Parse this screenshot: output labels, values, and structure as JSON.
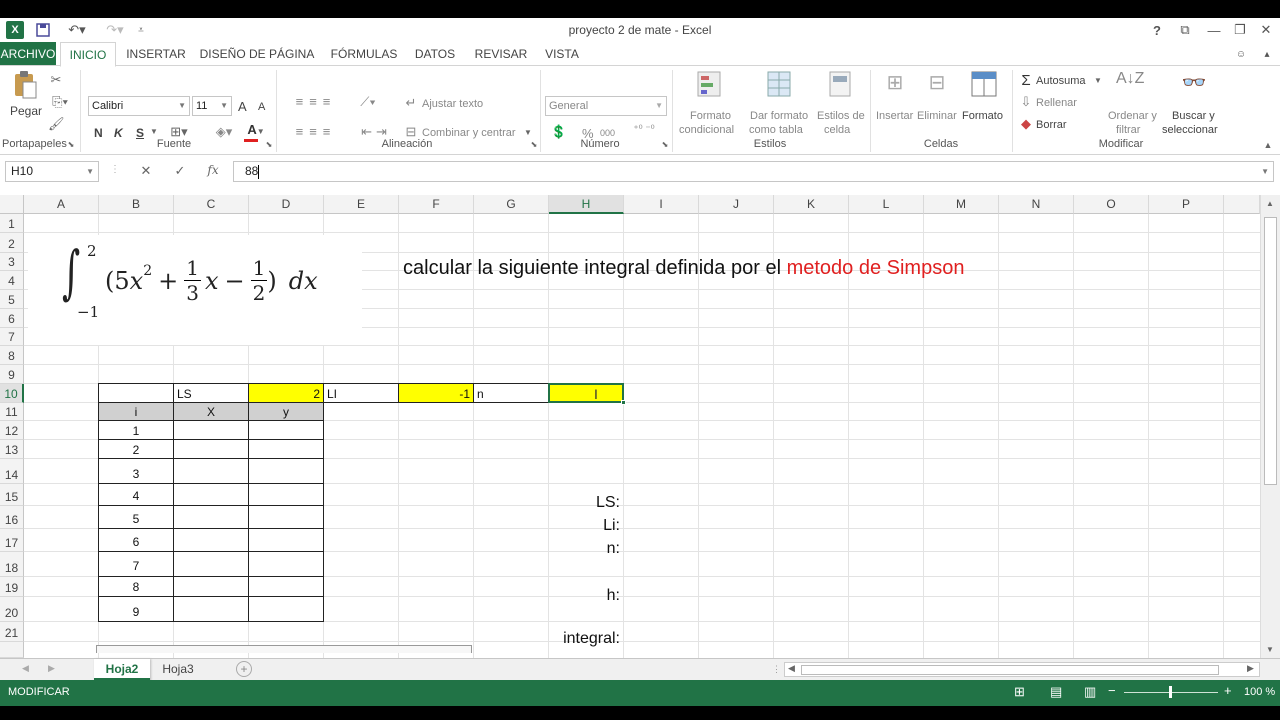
{
  "app": {
    "title": "proyecto 2 de mate - Excel",
    "logo_letter": "X",
    "quick_access": [
      "save-icon",
      "undo-icon",
      "redo-icon",
      "customize-icon"
    ],
    "window_controls": [
      "?",
      "⧉",
      "—",
      "❐",
      "✕"
    ]
  },
  "tabs": [
    "ARCHIVO",
    "INICIO",
    "INSERTAR",
    "DISEÑO DE PÁGINA",
    "FÓRMULAS",
    "DATOS",
    "REVISAR",
    "VISTA"
  ],
  "ribbon": {
    "clipboard": {
      "paste": "Pegar",
      "group": "Portapapeles"
    },
    "font": {
      "name": "Calibri",
      "size": "11",
      "bold": "N",
      "italic": "K",
      "underline": "S",
      "grow": "A",
      "shrink": "A",
      "group": "Fuente"
    },
    "alignment": {
      "wrap": "Ajustar texto",
      "merge": "Combinar y centrar",
      "group": "Alineación"
    },
    "number": {
      "format": "General",
      "percent": "%",
      "thousands": "000",
      "group": "Número"
    },
    "styles": {
      "conditional_1": "Formato",
      "conditional_2": "condicional",
      "table_1": "Dar formato",
      "table_2": "como tabla",
      "cell_1": "Estilos de",
      "cell_2": "celda",
      "group": "Estilos"
    },
    "cells": {
      "insert": "Insertar",
      "delete": "Eliminar",
      "format": "Formato",
      "group": "Celdas"
    },
    "editing": {
      "autosum": "Autosuma",
      "fill": "Rellenar",
      "clear": "Borrar",
      "sort_1": "Ordenar y",
      "sort_2": "filtrar",
      "find_1": "Buscar y",
      "find_2": "seleccionar",
      "group": "Modificar"
    }
  },
  "formula_bar": {
    "name_box": "H10",
    "cancel": "✕",
    "enter": "✓",
    "fx": "fx",
    "value": "88"
  },
  "columns": [
    "A",
    "B",
    "C",
    "D",
    "E",
    "F",
    "G",
    "H",
    "I",
    "J",
    "K",
    "L",
    "M",
    "N",
    "O",
    "P"
  ],
  "rows": [
    "1",
    "2",
    "3",
    "4",
    "5",
    "6",
    "7",
    "8",
    "9",
    "10",
    "11",
    "12",
    "13",
    "14",
    "15",
    "16",
    "17",
    "18",
    "19",
    "20",
    "21"
  ],
  "selected": {
    "column": "H",
    "row": "10"
  },
  "sheet": {
    "heading_black": "calcular la siguiente integral definida por el ",
    "heading_red": "metodo de Simpson",
    "heading_red_color": "#e02020",
    "highlight_color": "#ffff00",
    "integral": {
      "upper": "2",
      "lower": "−1",
      "open": "(",
      "t1": "5",
      "x1": "x",
      "exp": "2",
      "plus": "+",
      "f1_num": "1",
      "f1_den": "3",
      "x2": "x",
      "minus": "−",
      "f2_num": "1",
      "f2_den": "2",
      "close": ")",
      "dx": "dx"
    },
    "row10": {
      "ls_label": "LS",
      "ls_value": "2",
      "li_label": "LI",
      "li_value": "-1",
      "n_label": "n"
    },
    "table_headers": {
      "i": "i",
      "x": "X",
      "y": "y"
    },
    "i_values": [
      "1",
      "2",
      "3",
      "4",
      "5",
      "6",
      "7",
      "8",
      "9"
    ],
    "labels": {
      "ls": "LS:",
      "li": "Li:",
      "n": "n:",
      "h": "h:",
      "integral": "integral:"
    }
  },
  "sheet_tabs": [
    "Hoja2",
    "Hoja3"
  ],
  "status": {
    "mode": "MODIFICAR",
    "zoom": "100 %"
  }
}
